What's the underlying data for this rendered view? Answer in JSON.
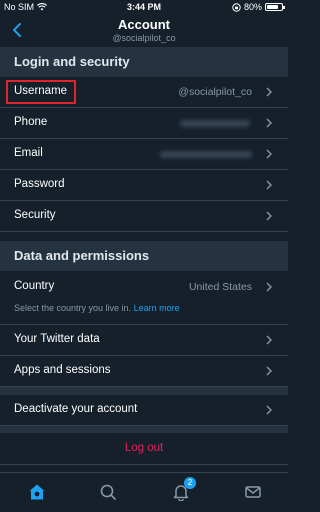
{
  "status_bar": {
    "carrier": "No SIM",
    "time": "3:44 PM",
    "battery": "80%",
    "battery_level": 0.8
  },
  "header": {
    "title": "Account",
    "subtitle": "@socialpilot_co"
  },
  "sections": {
    "login": {
      "title": "Login and security",
      "rows": [
        {
          "label": "Username",
          "value": "@socialpilot_co"
        },
        {
          "label": "Phone",
          "value": ""
        },
        {
          "label": "Email",
          "value": ""
        },
        {
          "label": "Password",
          "value": ""
        },
        {
          "label": "Security",
          "value": ""
        }
      ]
    },
    "data": {
      "title": "Data and permissions",
      "country": {
        "label": "Country",
        "value": "United States",
        "hint": "Select the country you live in.",
        "hint_link": "Learn more"
      },
      "rows": [
        {
          "label": "Your Twitter data"
        },
        {
          "label": "Apps and sessions"
        }
      ]
    }
  },
  "deactivate": {
    "label": "Deactivate your account"
  },
  "logout": {
    "label": "Log out"
  },
  "tabbar": {
    "notification_count": "2"
  },
  "colors": {
    "background": "#15202b",
    "section": "#253341",
    "accent": "#1da1f2",
    "danger": "#e0245e",
    "highlight": "#e0242c"
  }
}
